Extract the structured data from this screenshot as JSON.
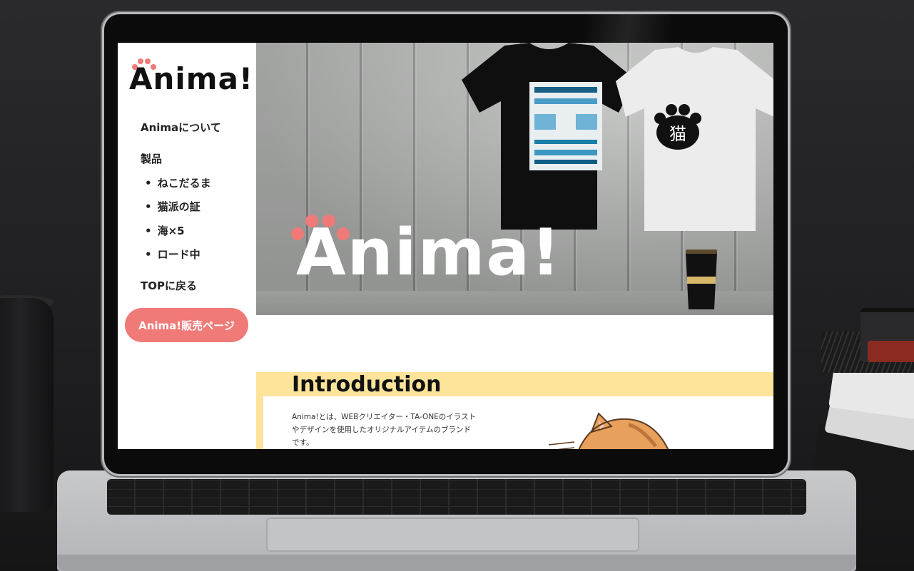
{
  "sidebar": {
    "logo_text": "Anima!",
    "nav": {
      "about": "Animaについて",
      "products": "製品",
      "product_items": [
        "ねこだるま",
        "猫派の証",
        "海×5",
        "ロード中"
      ],
      "back_to_top": "TOPに戻る"
    },
    "cta_label": "Anima!販売ページ"
  },
  "hero": {
    "logo_text": "Anima!",
    "shirt_print": "猫"
  },
  "intro": {
    "title": "Introduction",
    "body": "Anima!とは、WEBクリエイター・TA-ONEのイラストやデザインを使用したオリジナルアイテムのブランドです。"
  },
  "colors": {
    "accent": "#f07a78",
    "intro_band": "#fde49a"
  }
}
